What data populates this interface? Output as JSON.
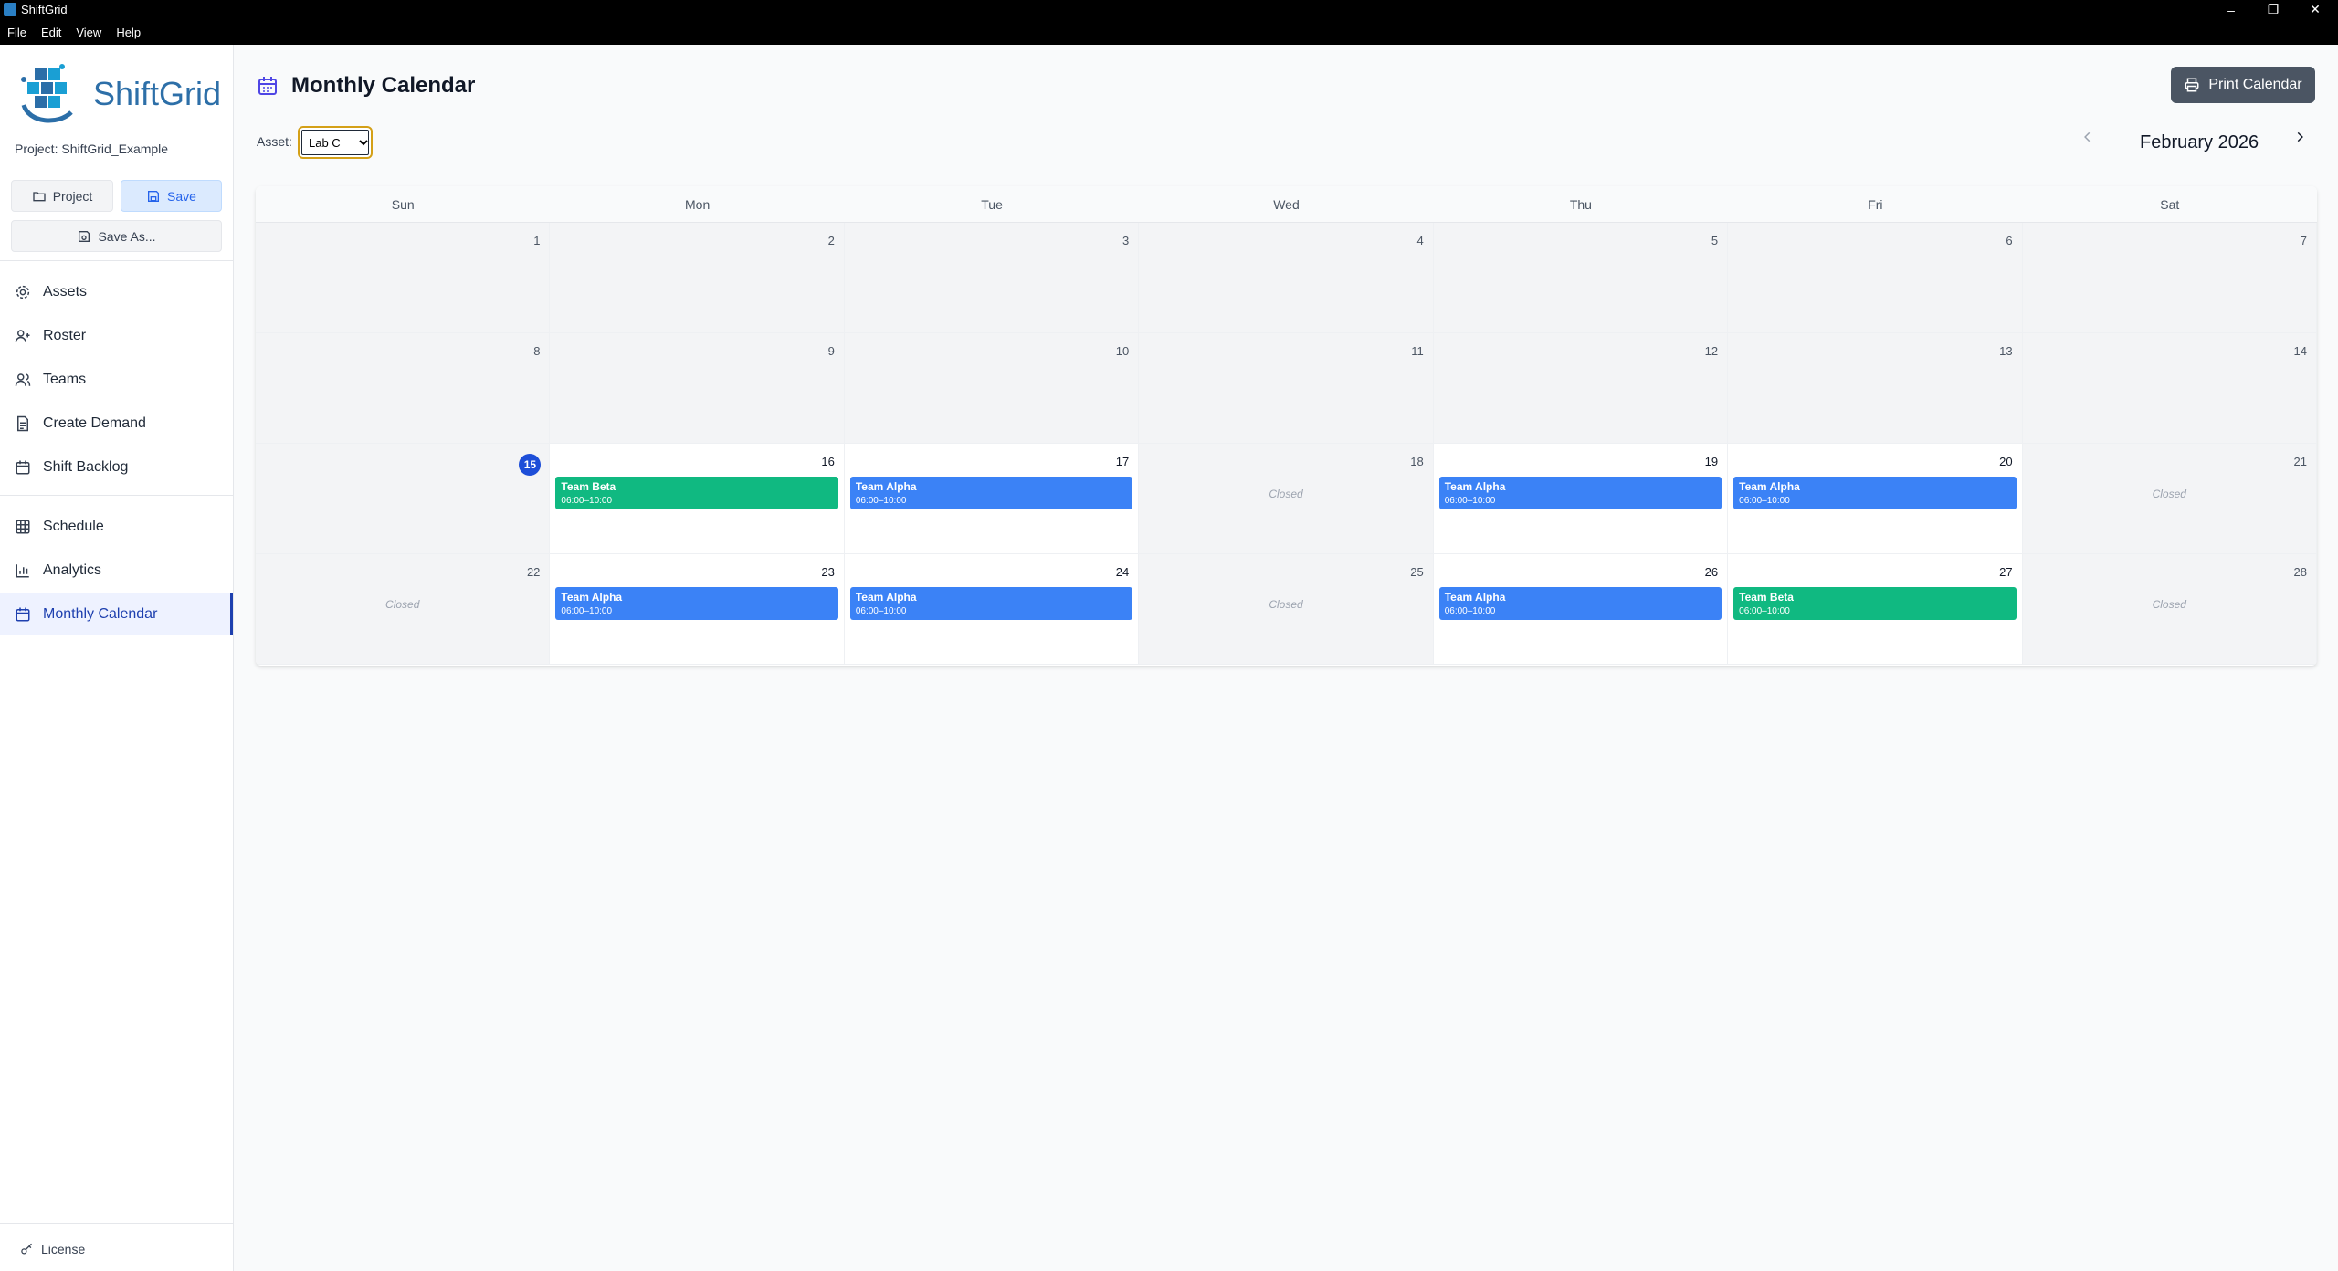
{
  "window": {
    "title": "ShiftGrid"
  },
  "menu": [
    "File",
    "Edit",
    "View",
    "Help"
  ],
  "sidebar": {
    "logo_text": "ShiftGrid",
    "project_label": "Project: ShiftGrid_Example",
    "buttons": {
      "project": "Project",
      "save": "Save",
      "save_as": "Save As..."
    },
    "nav": [
      {
        "label": "Assets",
        "icon": "gear-icon"
      },
      {
        "label": "Roster",
        "icon": "user-plus-icon"
      },
      {
        "label": "Teams",
        "icon": "users-icon"
      },
      {
        "label": "Create Demand",
        "icon": "document-icon"
      },
      {
        "label": "Shift Backlog",
        "icon": "calendar-icon"
      },
      {
        "label": "Schedule",
        "icon": "grid-icon"
      },
      {
        "label": "Analytics",
        "icon": "bar-chart-icon"
      },
      {
        "label": "Monthly Calendar",
        "icon": "calendar-icon",
        "active": true
      }
    ],
    "license": "License"
  },
  "main": {
    "title": "Monthly Calendar",
    "print_button": "Print Calendar",
    "asset_label": "Asset:",
    "asset_value": "Lab C",
    "month": "February 2026"
  },
  "calendar": {
    "weekdays": [
      "Sun",
      "Mon",
      "Tue",
      "Wed",
      "Thu",
      "Fri",
      "Sat"
    ],
    "today": 15,
    "closed_label": "Closed",
    "weeks": [
      [
        {
          "day": 1
        },
        {
          "day": 2
        },
        {
          "day": 3
        },
        {
          "day": 4
        },
        {
          "day": 5
        },
        {
          "day": 6
        },
        {
          "day": 7
        }
      ],
      [
        {
          "day": 8
        },
        {
          "day": 9
        },
        {
          "day": 10
        },
        {
          "day": 11
        },
        {
          "day": 12
        },
        {
          "day": 13
        },
        {
          "day": 14
        }
      ],
      [
        {
          "day": 15
        },
        {
          "day": 16,
          "open": true,
          "shift": {
            "team": "Team Beta",
            "time": "06:00–10:00",
            "kind": "beta"
          }
        },
        {
          "day": 17,
          "open": true,
          "shift": {
            "team": "Team Alpha",
            "time": "06:00–10:00",
            "kind": "alpha"
          }
        },
        {
          "day": 18,
          "closed": true
        },
        {
          "day": 19,
          "open": true,
          "shift": {
            "team": "Team Alpha",
            "time": "06:00–10:00",
            "kind": "alpha"
          }
        },
        {
          "day": 20,
          "open": true,
          "shift": {
            "team": "Team Alpha",
            "time": "06:00–10:00",
            "kind": "alpha"
          }
        },
        {
          "day": 21,
          "closed": true
        }
      ],
      [
        {
          "day": 22,
          "closed": true
        },
        {
          "day": 23,
          "open": true,
          "shift": {
            "team": "Team Alpha",
            "time": "06:00–10:00",
            "kind": "alpha"
          }
        },
        {
          "day": 24,
          "open": true,
          "shift": {
            "team": "Team Alpha",
            "time": "06:00–10:00",
            "kind": "alpha"
          }
        },
        {
          "day": 25,
          "closed": true
        },
        {
          "day": 26,
          "open": true,
          "shift": {
            "team": "Team Alpha",
            "time": "06:00–10:00",
            "kind": "alpha"
          }
        },
        {
          "day": 27,
          "open": true,
          "shift": {
            "team": "Team Beta",
            "time": "06:00–10:00",
            "kind": "beta"
          }
        },
        {
          "day": 28,
          "closed": true
        }
      ]
    ]
  },
  "colors": {
    "team_alpha": "#3b82f6",
    "team_beta": "#10b981",
    "today_badge": "#1d4ed8"
  }
}
